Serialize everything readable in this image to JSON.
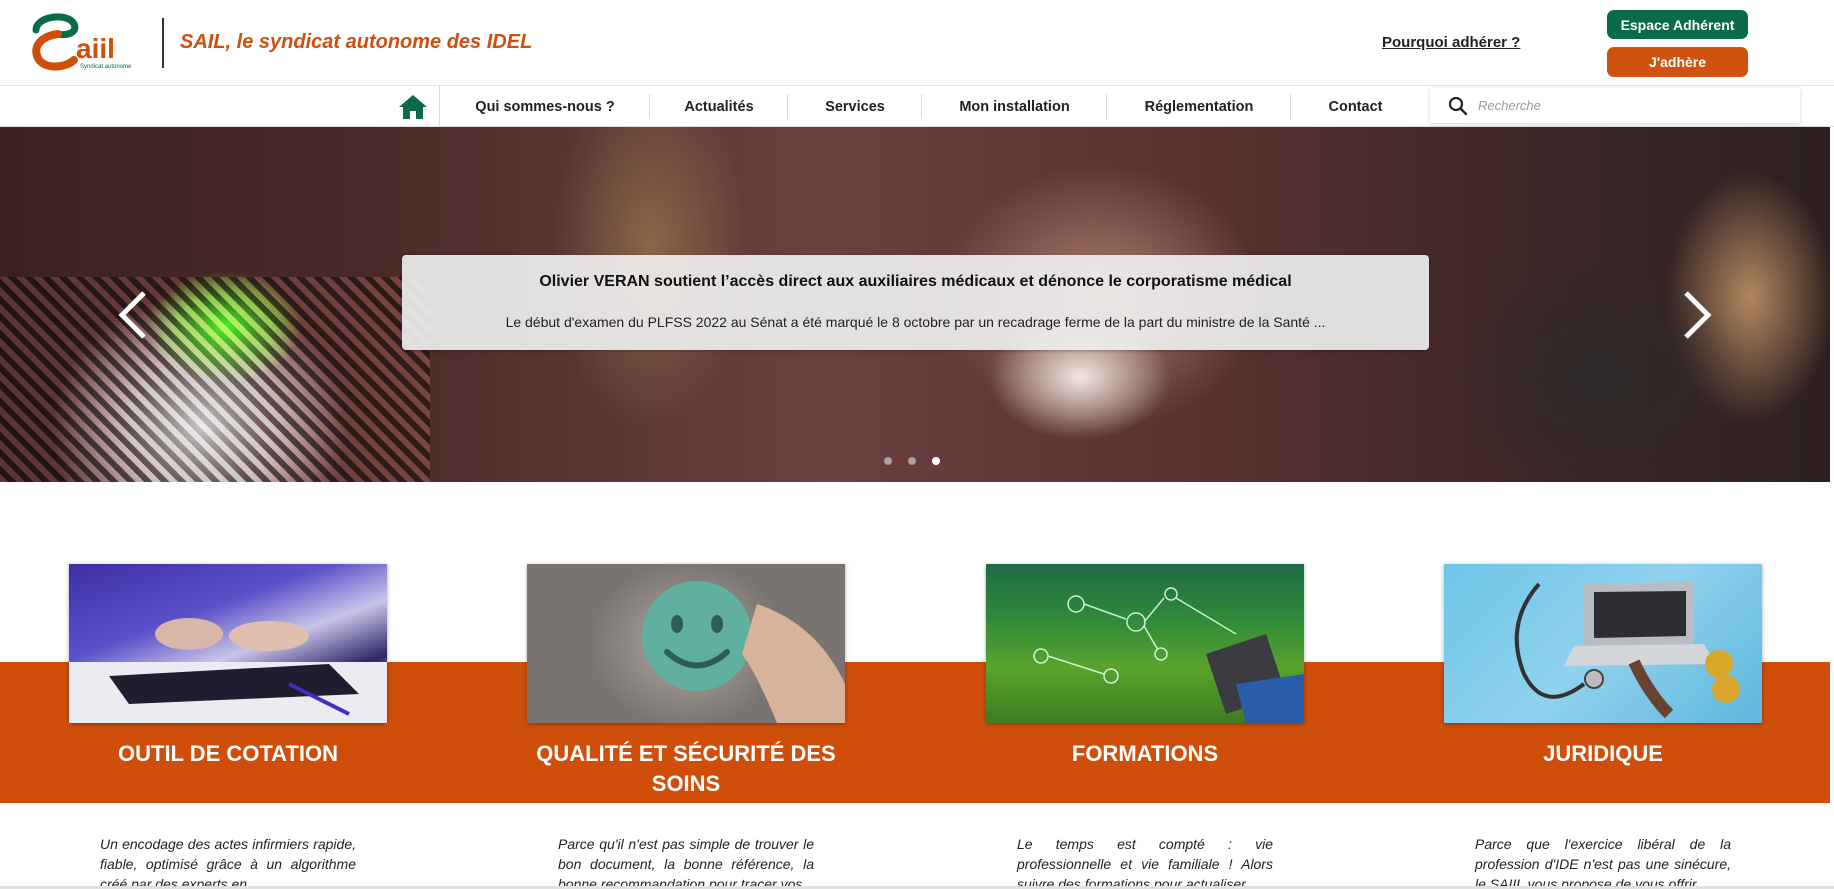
{
  "header": {
    "tagline": "SAIL, le syndicat autonome des IDEL",
    "logo_text": "saiil",
    "logo_subtext": "Syndicat autonome",
    "why_join_link": "Pourquoi adhérer ?",
    "member_space_button": "Espace Adhérent",
    "join_button": "J'adhère"
  },
  "nav": {
    "home_icon": "home-icon",
    "items": [
      {
        "label": "Qui sommes-nous ?"
      },
      {
        "label": "Actualités"
      },
      {
        "label": "Services"
      },
      {
        "label": "Mon installation"
      },
      {
        "label": "Réglementation"
      },
      {
        "label": "Contact"
      }
    ],
    "search": {
      "placeholder": "Recherche",
      "value": ""
    }
  },
  "hero": {
    "title": "Olivier VERAN soutient l’accès direct aux auxiliaires médicaux et dénonce le corporatisme médical",
    "text": "Le début d'examen du PLFSS 2022 au Sénat a été marqué le 8 octobre par un recadrage ferme de la part du ministre de la Santé ...",
    "slides_count": 3,
    "active_slide": 3
  },
  "cards": [
    {
      "title": "OUTIL DE COTATION",
      "text": "Un encodage des actes infirmiers rapide, fiable, optimisé grâce à un algorithme créé par des experts en"
    },
    {
      "title": "QUALITÉ ET SÉCURITÉ DES SOINS",
      "text": "Parce qu'il n'est pas simple de trouver le bon document, la bonne référence, la bonne recommandation pour tracer vos"
    },
    {
      "title": "FORMATIONS",
      "text": "Le temps est compté : vie professionnelle et vie familiale ! Alors suivre des formations pour actualiser"
    },
    {
      "title": "JURIDIQUE",
      "text": "Parce que l'exercice libéral de la profession d'IDE n'est pas une sinécure, le SAIIL vous propose de vous offrir"
    }
  ],
  "colors": {
    "brand_orange": "#cf4e0a",
    "brand_green": "#0a6b4b"
  }
}
